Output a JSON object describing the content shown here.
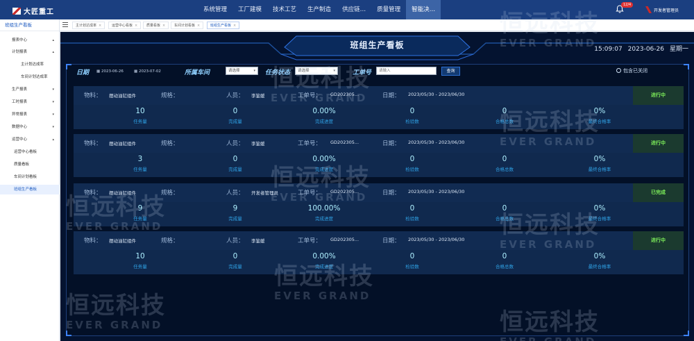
{
  "brand": "大匠重工",
  "menu": [
    "系统管理",
    "工厂建模",
    "技术工艺",
    "生产制造",
    "供应链…",
    "质量管理",
    "智能决…"
  ],
  "notifications_badge": "12/4",
  "user_name": "开发者管理员",
  "sidebar": {
    "title": "班组生产看板",
    "items": [
      {
        "label": "报表中心",
        "icon": "▴",
        "active": false
      },
      {
        "label": "计划报表",
        "icon": "▴",
        "active": false
      },
      {
        "label": "主计划达成率",
        "icon": "",
        "active": false
      },
      {
        "label": "车间计划达成率",
        "icon": "",
        "active": false
      },
      {
        "label": "生产报表",
        "icon": "▾",
        "active": false
      },
      {
        "label": "工时报表",
        "icon": "▾",
        "active": false
      },
      {
        "label": "异常报表",
        "icon": "▾",
        "active": false
      },
      {
        "label": "数据中心",
        "icon": "▾",
        "active": false
      },
      {
        "label": "运营中心",
        "icon": "▴",
        "active": false
      },
      {
        "label": "运营中心看板",
        "icon": "",
        "active": false
      },
      {
        "label": "质量看板",
        "icon": "",
        "active": false
      },
      {
        "label": "车间计划看板",
        "icon": "",
        "active": false
      },
      {
        "label": "班组生产看板",
        "icon": "",
        "active": true
      }
    ]
  },
  "tabs": [
    {
      "label": "主计划达成率",
      "active": false
    },
    {
      "label": "运营中心看板",
      "active": false
    },
    {
      "label": "质量看板",
      "active": false
    },
    {
      "label": "车间计划看板",
      "active": false
    },
    {
      "label": "班组生产看板",
      "active": true
    }
  ],
  "board": {
    "title": "班组生产看板",
    "time": "15:09:07",
    "date": "2023-06-26",
    "weekday": "星期一"
  },
  "filter": {
    "date_label": "日期",
    "date_start": "2023-06-26",
    "date_end": "2023-07-02",
    "workshop_label": "所属车间",
    "workshop_placeholder": "请选择",
    "status_label": "任务状态",
    "status_placeholder": "请选择",
    "order_label": "工单号",
    "order_placeholder": "请输入",
    "query_button": "查询",
    "include_closed": "包含已关闭"
  },
  "labels": {
    "material": "物料：",
    "spec": "规格：",
    "personnel": "人员：",
    "order_no": "工单号：",
    "date": "日期："
  },
  "metric_labels": [
    "任务量",
    "完成量",
    "完成进度",
    "检验数",
    "合格总数",
    "最终合格率"
  ],
  "cards": [
    {
      "material": "摆动油缸组件",
      "spec": "",
      "personnel": "李鉴媛",
      "order_no": "GD202305...",
      "date": "2023/05/30 - 2023/06/30",
      "status": "进行中",
      "status_color": "#7ef05a",
      "metrics": [
        "10",
        "0",
        "0.00%",
        "0",
        "0",
        "0%"
      ]
    },
    {
      "material": "摆动油缸组件",
      "spec": "",
      "personnel": "李鉴媛",
      "order_no": "GD202305...",
      "date": "2023/05/30 - 2023/06/30",
      "status": "进行中",
      "status_color": "#7ef05a",
      "metrics": [
        "3",
        "0",
        "0.00%",
        "0",
        "0",
        "0%"
      ]
    },
    {
      "material": "摆动油缸组件",
      "spec": "",
      "personnel": "开发者管理员",
      "order_no": "GD202305...",
      "date": "2023/05/30 - 2023/06/30",
      "status": "已完成",
      "status_color": "#7ef05a",
      "metrics": [
        "9",
        "9",
        "100.00%",
        "0",
        "0",
        "0%"
      ]
    },
    {
      "material": "摆动油缸组件",
      "spec": "",
      "personnel": "李鉴媛",
      "order_no": "GD202305...",
      "date": "2023/05/30 - 2023/06/30",
      "status": "进行中",
      "status_color": "#7ef05a",
      "metrics": [
        "10",
        "0",
        "0.00%",
        "0",
        "0",
        "0%"
      ]
    }
  ],
  "watermark": {
    "cn": "恒远科技",
    "en": "EVER GRAND"
  },
  "colors": {
    "topbar": "#1b3f80",
    "board_bg": "#041330",
    "accent": "#1f5cc1",
    "metric_value": "#aef0ff",
    "metric_label": "#2fa2e6"
  }
}
